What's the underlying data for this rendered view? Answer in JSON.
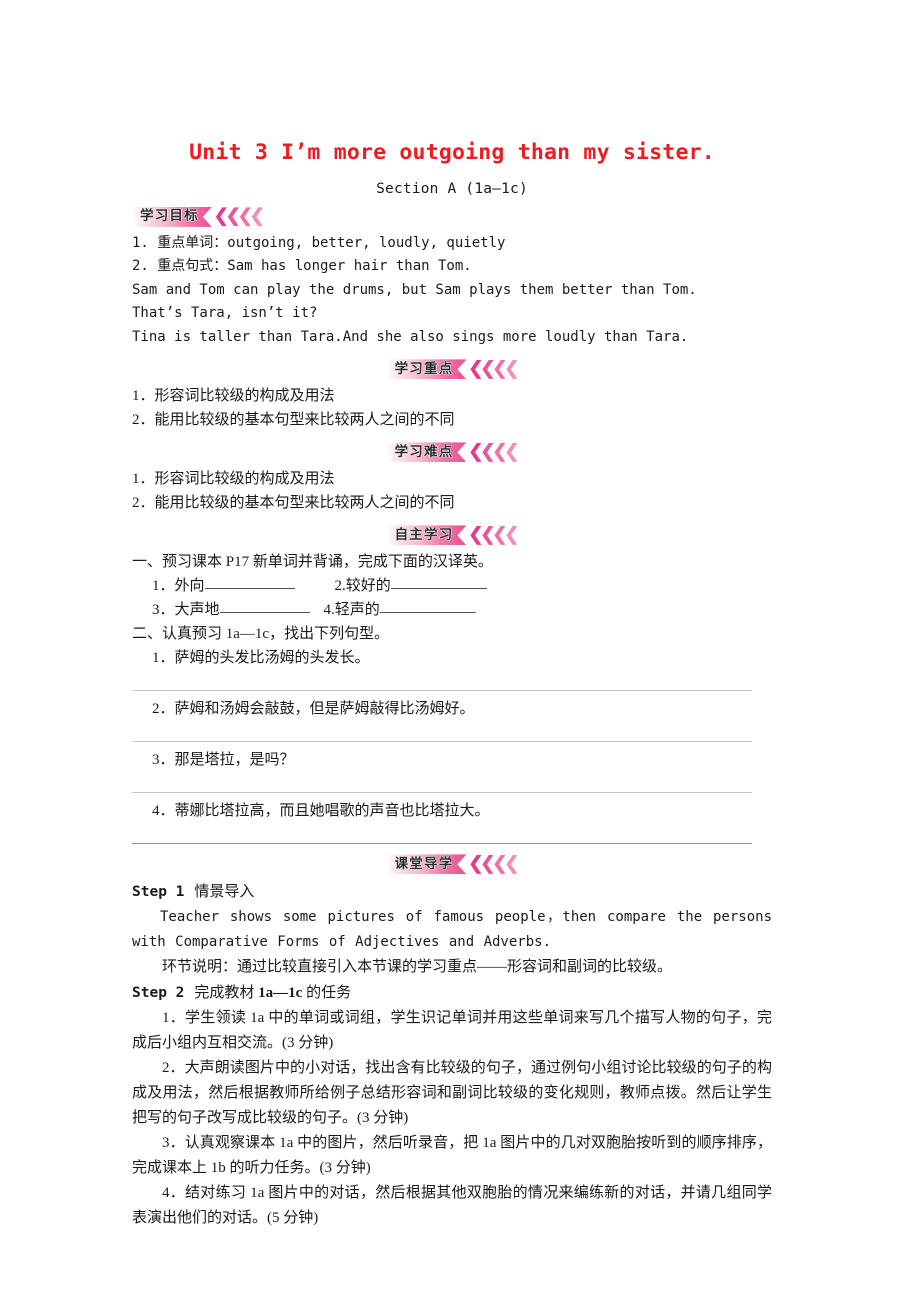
{
  "title": "Unit 3  I’m more outgoing than my sister.",
  "subtitle": "Section A (1a—1c)",
  "sections": {
    "objectives": {
      "banner": "学习目标",
      "lines": [
        "1. 重点单词：outgoing, better, loudly, quietly",
        "2. 重点句式：Sam has longer hair than Tom.",
        "Sam and Tom can play the drums, but Sam plays them better than Tom.",
        "That’s Tara, isn’t it?",
        "Tina is taller than Tara.And she also sings more loudly than Tara."
      ]
    },
    "key_points": {
      "banner": "学习重点",
      "lines": [
        "1．形容词比较级的构成及用法",
        "2．能用比较级的基本句型来比较两人之间的不同"
      ]
    },
    "difficult_points": {
      "banner": "学习难点",
      "lines": [
        "1．形容词比较级的构成及用法",
        "2．能用比较级的基本句型来比较两人之间的不同"
      ]
    },
    "self_study": {
      "banner": "自主学习",
      "task_one": "一、预习课本 P17 新单词并背诵，完成下面的汉译英。",
      "vocab": [
        {
          "num": "1．",
          "cn": "外向"
        },
        {
          "num": "2.",
          "cn": "较好的"
        },
        {
          "num": "3．",
          "cn": "大声地"
        },
        {
          "num": "4.",
          "cn": "轻声的"
        }
      ],
      "task_two": "二、认真预习 1a—1c，找出下列句型。",
      "sentences": [
        "1．萨姆的头发比汤姆的头发长。",
        "2．萨姆和汤姆会敲鼓，但是萨姆敲得比汤姆好。",
        "3．那是塔拉，是吗？",
        "4．蒂娜比塔拉高，而且她唱歌的声音也比塔拉大。"
      ]
    },
    "guided_learning": {
      "banner": "课堂导学",
      "step1": {
        "label": "Step 1",
        "title": "情景导入"
      },
      "step1_en": "Teacher shows some pictures of famous people，then compare the persons with Comparative Forms of Adjectives and Adverbs.",
      "step1_note": "环节说明：通过比较直接引入本节课的学习重点——形容词和副词的比较级。",
      "step2": {
        "label": "Step 2",
        "title_pre": "完成教材 ",
        "title_bold": "1a—1c",
        "title_post": " 的任务"
      },
      "step2_items": [
        "1．学生领读 1a 中的单词或词组，学生识记单词并用这些单词来写几个描写人物的句子，完成后小组内互相交流。(3 分钟)",
        "2．大声朗读图片中的小对话，找出含有比较级的句子，通过例句小组讨论比较级的句子的构成及用法，然后根据教师所给例子总结形容词和副词比较级的变化规则，教师点拨。然后让学生把写的句子改写成比较级的句子。(3 分钟)",
        "3．认真观察课本 1a 中的图片，然后听录音，把 1a 图片中的几对双胞胎按听到的顺序排序，完成课本上 1b 的听力任务。(3 分钟)",
        "4．结对练习 1a 图片中的对话，然后根据其他双胞胎的情况来编练新的对话，并请几组同学表演出他们的对话。(5 分钟)"
      ]
    }
  },
  "colors": {
    "title_red": "#ee1c22",
    "banner_pink": "#ea4f93",
    "chevron_pink": "#e8378c",
    "rule_gray": "#c9c9c9"
  }
}
